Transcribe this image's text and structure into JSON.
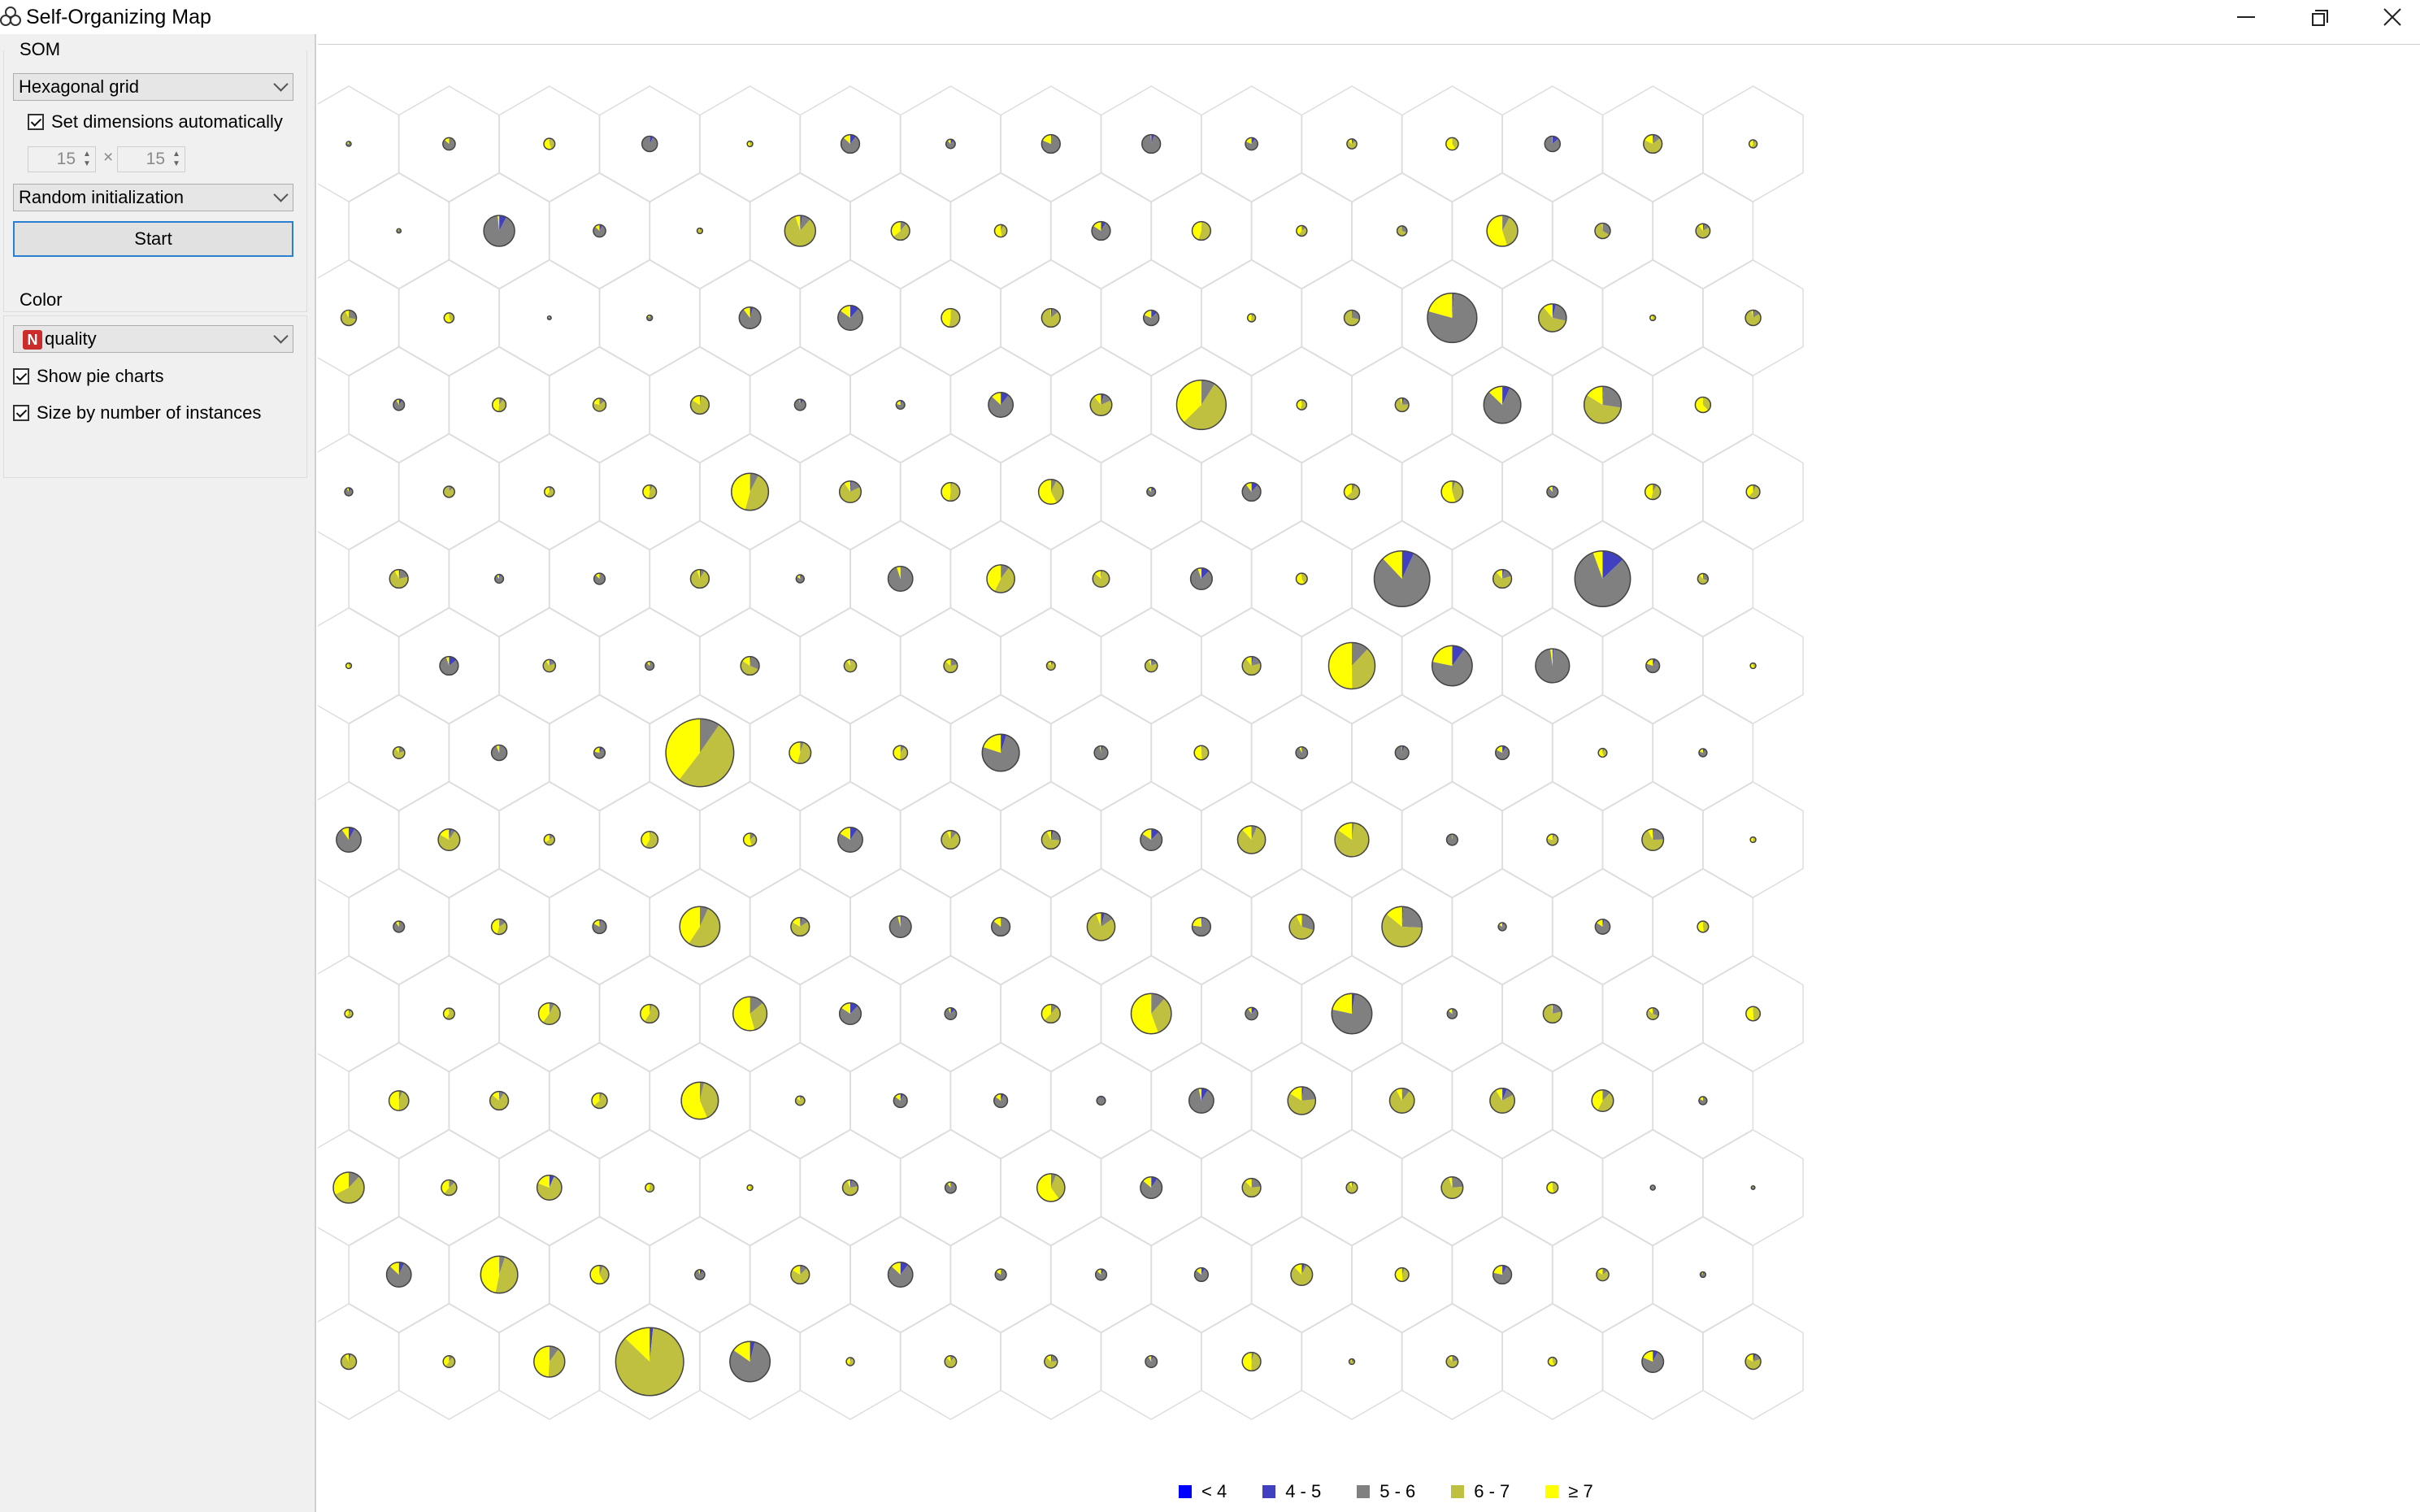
{
  "window": {
    "title": "Self-Organizing Map",
    "icons": {
      "app": "orange-icon",
      "minimize": "minimize-icon",
      "maximize": "restore-icon",
      "close": "close-icon"
    }
  },
  "controls": {
    "som_label": "SOM",
    "grid_type": "Hexagonal grid",
    "auto_dims_label": "Set dimensions automatically",
    "auto_dims_checked": true,
    "width": "15",
    "height": "15",
    "times": "×",
    "initialization": "Random initialization",
    "start_label": "Start",
    "color_label": "Color",
    "color_attr_badge": "N",
    "color_attr": "quality",
    "show_pie_label": "Show pie charts",
    "show_pie_checked": true,
    "size_label": "Size by number of instances",
    "size_checked": true
  },
  "legend": [
    {
      "label": "< 4",
      "color": "#0000ff"
    },
    {
      "label": "4 - 5",
      "color": "#4040c0"
    },
    {
      "label": "5 - 6",
      "color": "#808080"
    },
    {
      "label": "6 - 7",
      "color": "#bfbf40"
    },
    {
      "label": "≥ 7",
      "color": "#ffff00"
    }
  ],
  "som": {
    "rows": 15,
    "cols": 15,
    "grid_type": "hexagonal",
    "cells": [
      [
        1.6,
        4,
        3.6,
        5,
        1.8,
        6,
        3,
        6,
        6,
        4,
        3.2,
        4,
        5,
        6,
        2.6
      ],
      [
        1.4,
        10,
        4,
        1.8,
        10,
        6,
        4,
        6,
        6,
        3.4,
        3.2,
        10,
        5,
        4.6
      ],
      [
        5,
        3.2,
        1.2,
        1.8,
        7,
        8,
        6,
        6,
        5,
        2.6,
        5,
        16,
        9,
        1.8,
        5
      ],
      [
        3.6,
        4.4,
        4.2,
        6,
        3.6,
        2.8,
        8,
        7,
        16,
        3.2,
        4.4,
        12,
        12,
        5
      ],
      [
        2.6,
        3.6,
        3.2,
        4.4,
        12,
        7,
        6,
        8,
        2.8,
        6,
        5,
        7,
        3.6,
        5,
        4.4
      ],
      [
        6,
        2.8,
        3.6,
        6,
        2.6,
        8,
        9,
        5.4,
        7,
        3.6,
        18,
        6,
        18,
        3.4
      ],
      [
        1.8,
        6,
        4,
        2.8,
        6,
        4,
        4.4,
        2.8,
        4,
        6,
        15,
        13,
        11,
        4.4,
        1.8
      ],
      [
        3.8,
        5,
        3.6,
        22,
        7,
        4.6,
        12,
        4.4,
        4.6,
        3.8,
        4.4,
        4.4,
        2.8,
        2.6
      ],
      [
        8,
        7,
        3.4,
        5.4,
        4.2,
        8,
        6,
        6,
        7,
        9,
        11,
        3.6,
        3.6,
        7,
        1.8
      ],
      [
        3.6,
        5,
        4.4,
        13,
        6,
        7,
        6,
        9,
        6,
        8,
        13,
        2.6,
        4.8,
        3.6
      ],
      [
        2.6,
        3.6,
        7,
        6,
        11,
        7,
        3.8,
        6,
        13,
        4,
        13,
        3.2,
        6,
        3.8,
        4.6
      ],
      [
        6.4,
        6,
        5,
        12,
        3,
        4.4,
        4.4,
        2.8,
        8,
        9,
        8,
        8,
        7,
        2.6
      ],
      [
        10,
        5,
        8,
        2.8,
        1.8,
        5,
        3.6,
        9,
        7,
        6,
        3.6,
        7,
        3.6,
        1.6,
        1.2
      ],
      [
        8,
        12,
        6,
        3.2,
        6,
        8,
        3.6,
        3.6,
        4.4,
        7,
        4.4,
        6,
        4,
        1.8
      ],
      [
        5,
        3.8,
        10,
        22,
        13,
        2.6,
        3.8,
        4.2,
        3.8,
        6,
        1.8,
        3.8,
        2.8,
        7,
        5
      ]
    ]
  }
}
